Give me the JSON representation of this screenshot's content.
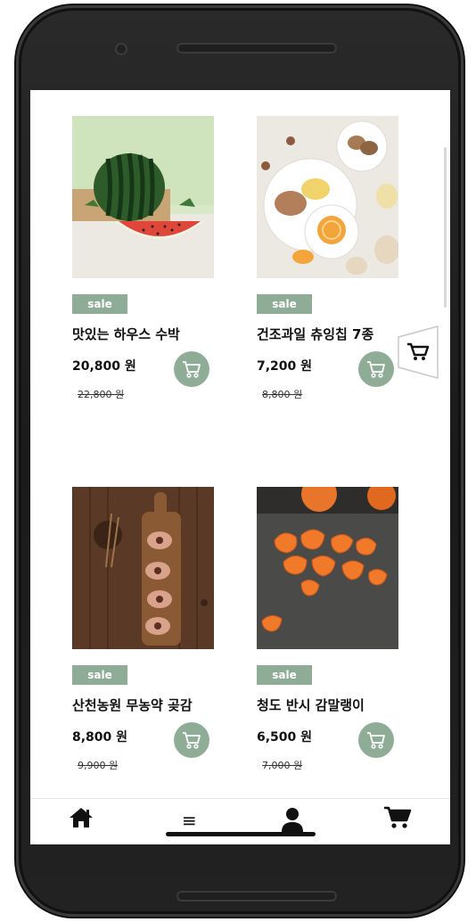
{
  "products": [
    {
      "name": "맛있는 하우스 수박",
      "price": "20,800 원",
      "old_price": "22,800 원",
      "badge": "sale"
    },
    {
      "name": "건조과일 츄잉칩 7종",
      "price": "7,200 원",
      "old_price": "8,800 원",
      "badge": "sale"
    },
    {
      "name": "산천농원 무농약 곶감",
      "price": "8,800 원",
      "old_price": "9,900 원",
      "badge": "sale"
    },
    {
      "name": "청도 반시 감말랭이",
      "price": "6,500 원",
      "old_price": "7,000 원",
      "badge": "sale"
    }
  ],
  "nav": {
    "icons": [
      "home-icon",
      "menu-icon",
      "user-icon",
      "cart-icon"
    ],
    "menu_glyph": "≡"
  },
  "colors": {
    "accent": "#8fac97",
    "phone": "#1a1a1a"
  }
}
